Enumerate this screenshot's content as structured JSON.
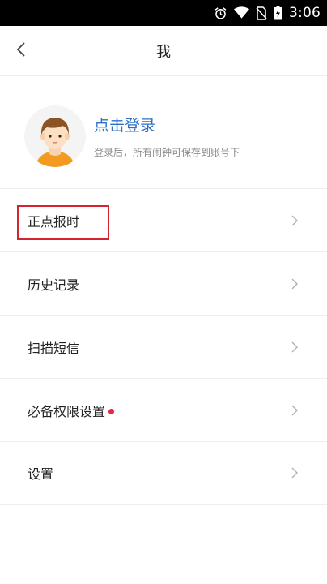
{
  "status_bar": {
    "time": "3:06",
    "icons": [
      "alarm-icon",
      "wifi-icon",
      "no-sim-icon",
      "battery-icon"
    ]
  },
  "header": {
    "title": "我",
    "back_icon": "chevron-left-icon"
  },
  "profile": {
    "avatar_icon": "avatar-boy-icon",
    "login_text": "点击登录",
    "hint_text": "登录后，所有闹钟可保存到账号下"
  },
  "menu": {
    "items": [
      {
        "label": "正点报时",
        "highlighted": true,
        "badge_dot": false
      },
      {
        "label": "历史记录",
        "highlighted": false,
        "badge_dot": false
      },
      {
        "label": "扫描短信",
        "highlighted": false,
        "badge_dot": false
      },
      {
        "label": "必备权限设置",
        "highlighted": false,
        "badge_dot": true
      },
      {
        "label": "设置",
        "highlighted": false,
        "badge_dot": false
      }
    ]
  },
  "colors": {
    "accent": "#2f70c7",
    "highlight_border": "#d6232d",
    "badge_dot": "#e8264a"
  }
}
